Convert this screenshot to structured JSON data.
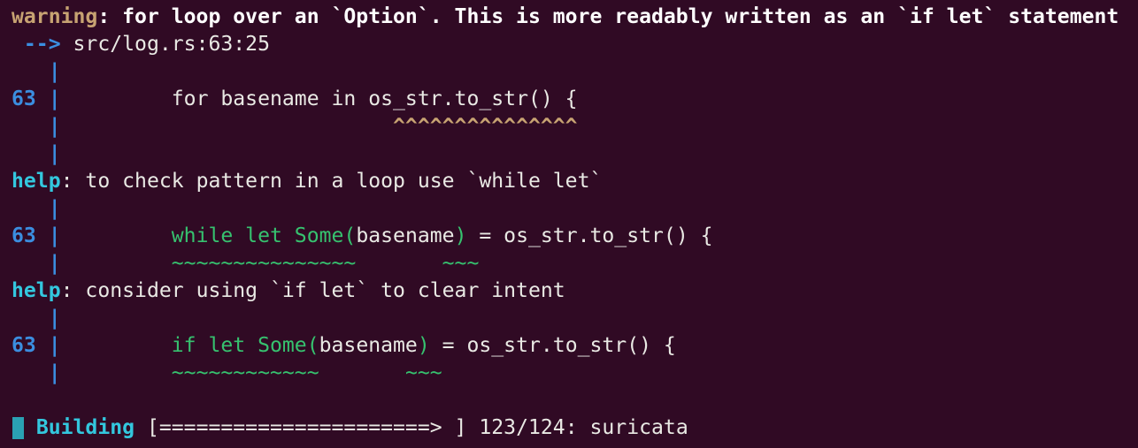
{
  "warning": {
    "level": "warning",
    "sep": ":",
    "message": " for loop over an `Option`. This is more readably written as an `if let` statement",
    "arrow": " -->",
    "location": " src/log.rs:63:25"
  },
  "gutter": {
    "bar": "|",
    "line_no": "63"
  },
  "snippet1": {
    "indent": "         ",
    "code": "for basename in os_str.to_str() {",
    "pad": "                  ",
    "carets": "^^^^^^^^^^^^^^^"
  },
  "help1": {
    "label": "help",
    "sep": ":",
    "message": " to check pattern in a loop use `while let`",
    "indent": "         ",
    "code_green": "while let Some(",
    "code_white": "basename",
    "code_green2": ")",
    "code_rest": " = os_str.to_str() {",
    "tilde1": "~~~~~~~~~~~~~~~",
    "tilde_gap": "       ",
    "tilde2": "~~~"
  },
  "help2": {
    "label": "help",
    "sep": ":",
    "message": " consider using `if let` to clear intent",
    "indent": "         ",
    "code_green": "if let Some(",
    "code_white": "basename",
    "code_green2": ")",
    "code_rest": " = os_str.to_str() {",
    "tilde1": "~~~~~~~~~~~~",
    "tilde_gap": "       ",
    "tilde2": "~~~"
  },
  "status": {
    "label": "Building",
    "progress_bar": "[======================> ]",
    "progress_value": 0.99,
    "counter": "123/124",
    "crate": ": suricata"
  },
  "colors": {
    "background": "#300a24",
    "warning": "#c7a372",
    "gutter": "#3b8ee0",
    "help": "#33c7de",
    "suggestion": "#36c26f"
  }
}
